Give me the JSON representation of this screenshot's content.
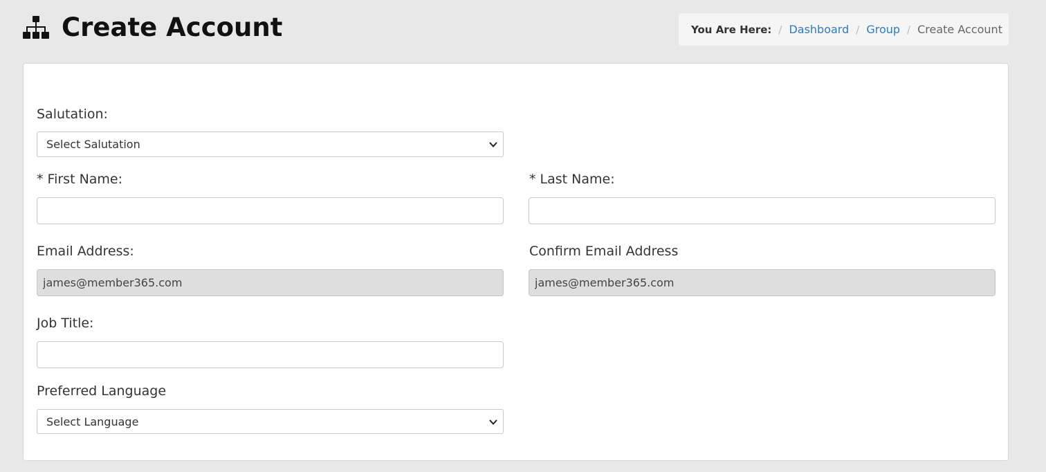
{
  "header": {
    "title": "Create Account",
    "icon": "sitemap-icon"
  },
  "breadcrumb": {
    "prefix": "You Are Here:",
    "separator": "/",
    "items": [
      {
        "label": "Dashboard"
      },
      {
        "label": "Group"
      },
      {
        "label": "Create Account"
      }
    ]
  },
  "form": {
    "salutation": {
      "label": "Salutation:",
      "selected": "Select Salutation"
    },
    "first_name": {
      "label": "* First Name:",
      "value": ""
    },
    "last_name": {
      "label": "* Last Name:",
      "value": ""
    },
    "email": {
      "label": "Email Address:",
      "value": "james@member365.com"
    },
    "confirm_email": {
      "label": "Confirm Email Address",
      "value": "james@member365.com"
    },
    "job_title": {
      "label": "Job Title:",
      "value": ""
    },
    "language": {
      "label": "Preferred Language",
      "selected": "Select Language"
    }
  },
  "colors": {
    "link": "#337ab7",
    "readonly_bg": "#dedede",
    "page_bg": "#e8e8e8"
  }
}
